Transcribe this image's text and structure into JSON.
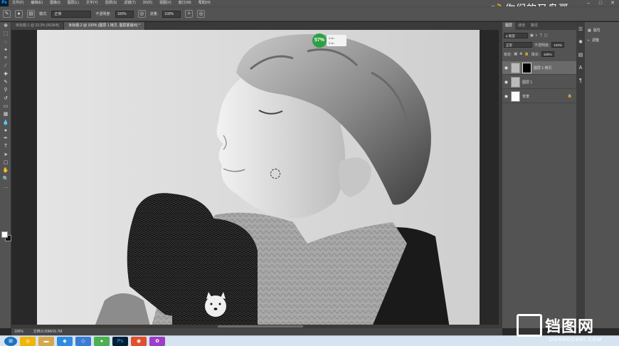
{
  "app": {
    "logo": "Ps"
  },
  "menu": [
    "文件(F)",
    "编辑(E)",
    "图像(I)",
    "图层(L)",
    "文字(Y)",
    "选择(S)",
    "滤镜(T)",
    "3D(D)",
    "视图(V)",
    "窗口(W)",
    "帮助(H)"
  ],
  "watermark": {
    "text": "你们的又鸟哥",
    "icon": "weibo-icon"
  },
  "options": {
    "mode_label": "模式:",
    "mode_value": "正常",
    "opacity_label": "不透明度:",
    "opacity_value": "100%",
    "flow_label": "流量:",
    "flow_value": "100%"
  },
  "tabs": [
    {
      "label": "未标题-1 @ 33.3% (RGB/8)",
      "active": false
    },
    {
      "label": "未标题-2 @ 100% (图层 1 拷贝, 图层蒙版/8) *",
      "active": true
    }
  ],
  "progress": {
    "percent": "57%",
    "line1": "0 kb",
    "line2": "0 kb"
  },
  "status": {
    "zoom": "100%",
    "doc": "文档:6.00M/16.7M"
  },
  "layers_panel": {
    "tabs": [
      "图层",
      "通道",
      "路径"
    ],
    "filter": "ρ 类型",
    "blend": "正常",
    "opacity_label": "不透明度:",
    "opacity": "100%",
    "lock_label": "锁定:",
    "fill_label": "填充:",
    "fill": "100%",
    "layers": [
      {
        "name": "图层 1 拷贝",
        "selected": true,
        "mask": true
      },
      {
        "name": "图层 1",
        "selected": false,
        "mask": false
      },
      {
        "name": "背景",
        "selected": false,
        "mask": false,
        "locked": true
      }
    ]
  },
  "props_panel": {
    "items": [
      "属性",
      "调整"
    ]
  },
  "brand": {
    "text": "铛图网",
    "sub": "DOANOOANI.COM"
  },
  "colors": {
    "accent_green": "#2ea043",
    "panel": "#535353",
    "taskbar": "#d6e3f0"
  }
}
